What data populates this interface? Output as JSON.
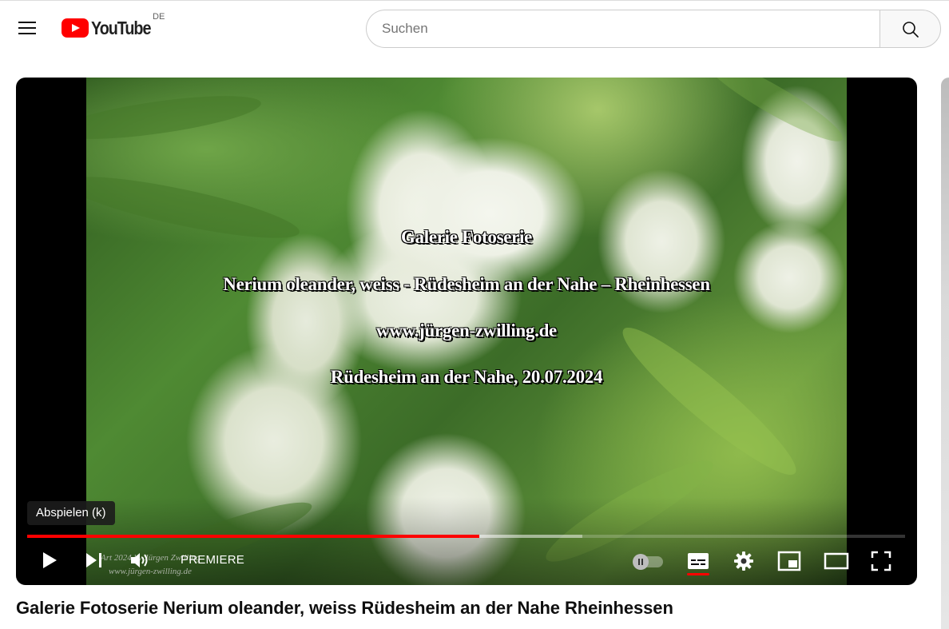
{
  "header": {
    "logo_text": "YouTube",
    "country_code": "DE",
    "search_placeholder": "Suchen"
  },
  "video": {
    "overlay_lines": [
      "Galerie Fotoserie",
      "Nerium oleander, weiss - Rüdesheim an der Nahe – Rheinhessen",
      "www.jürgen-zwilling.de",
      "Rüdesheim an der Nahe,  20.07.2024"
    ],
    "watermark_lines": [
      "Art 2024 by Jürgen Zwilling",
      "www.jürgen-zwilling.de"
    ]
  },
  "controls": {
    "tooltip": "Abspielen (k)",
    "premiere_label": "PREMIERE",
    "progress_played": 0.515,
    "progress_loaded": 0.632,
    "autoplay_on": false,
    "subtitles_on": true
  },
  "icons": [
    "menu-icon",
    "youtube-logo-icon",
    "search-icon",
    "play-icon",
    "next-icon",
    "volume-icon",
    "autoplay-toggle-icon",
    "subtitles-icon",
    "settings-icon",
    "miniplayer-icon",
    "theater-icon",
    "fullscreen-icon"
  ],
  "colors": {
    "brand_red": "#ff0000",
    "progress_red": "#ff0000"
  },
  "title": "Galerie Fotoserie Nerium oleander, weiss Rüdesheim an der Nahe Rheinhessen"
}
